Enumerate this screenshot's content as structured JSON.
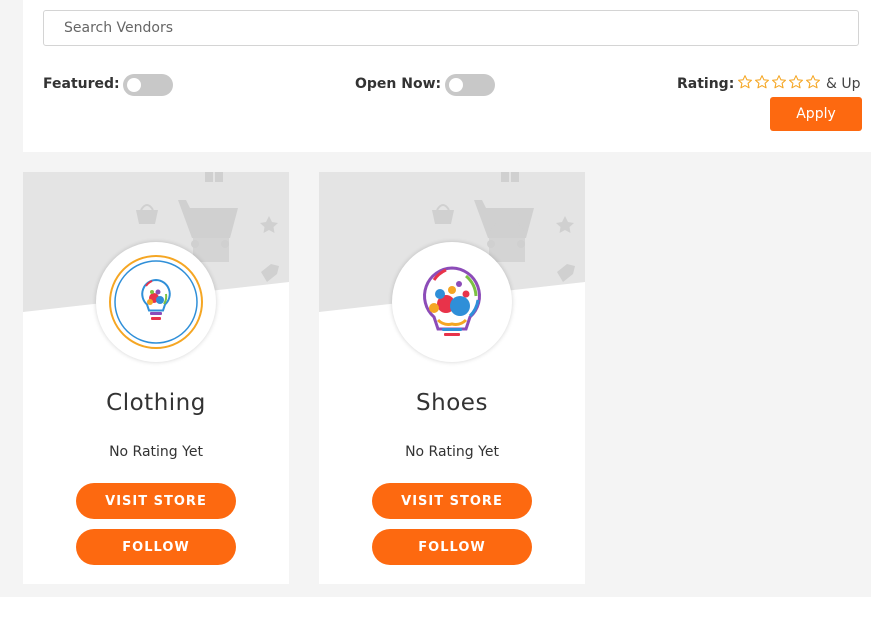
{
  "search": {
    "placeholder": "Search Vendors",
    "value": ""
  },
  "filters": {
    "featured_label": "Featured:",
    "featured_on": false,
    "open_now_label": "Open Now:",
    "open_now_on": false,
    "rating_label": "Rating:",
    "rating_stars": 5,
    "rating_selected": 0,
    "rating_suffix": "& Up",
    "apply_label": "Apply"
  },
  "vendors": [
    {
      "name": "Clothing",
      "rating_text": "No Rating Yet",
      "visit_label": "VISIT STORE",
      "follow_label": "FOLLOW",
      "logo_icon": "lightbulb-paint-icon"
    },
    {
      "name": "Shoes",
      "rating_text": "No Rating Yet",
      "visit_label": "VISIT STORE",
      "follow_label": "FOLLOW",
      "logo_icon": "lightbulb-paint-icon"
    }
  ],
  "colors": {
    "accent": "#fd6910",
    "toggle_off": "#c8c8c8",
    "star_outline": "#f5a623",
    "page_bg": "#f4f4f4"
  }
}
